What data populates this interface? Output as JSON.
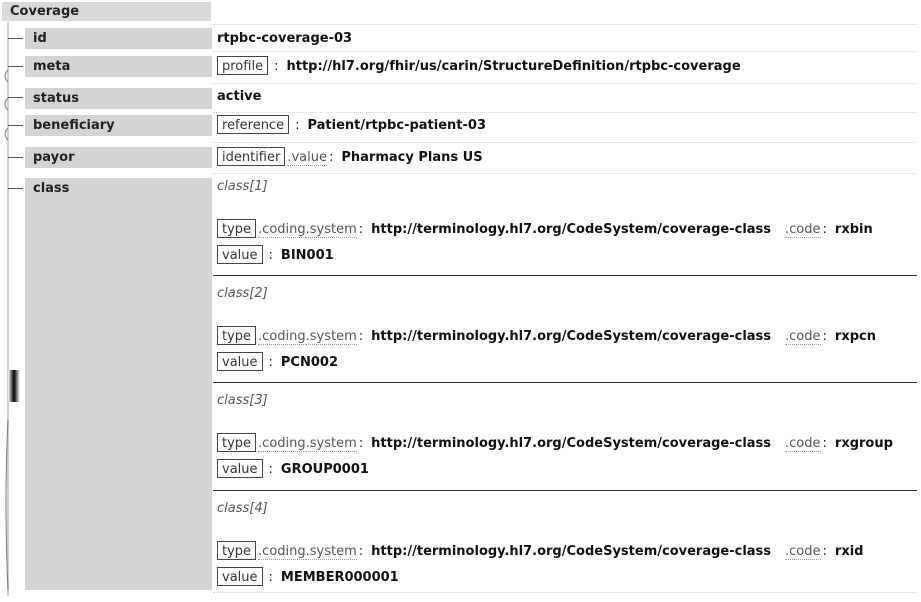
{
  "root": {
    "label": "Coverage"
  },
  "fields": {
    "id": {
      "label": "id",
      "value": "rtpbc-coverage-03"
    },
    "meta": {
      "label": "meta",
      "key": "profile",
      "value": "http://hl7.org/fhir/us/carin/StructureDefinition/rtpbc-coverage"
    },
    "status": {
      "label": "status",
      "value": "active"
    },
    "beneficiary": {
      "label": "beneficiary",
      "key": "reference",
      "value": "Patient/rtpbc-patient-03"
    },
    "payor": {
      "label": "payor",
      "key": "identifier",
      "sub": ".value",
      "value": "Pharmacy Plans US"
    },
    "class": {
      "label": "class"
    }
  },
  "common": {
    "type_key": "type",
    "coding": ".coding",
    "system_sub": ".system",
    "code_sub": ".code",
    "value_key": "value",
    "colon": ":"
  },
  "classes": [
    {
      "index": "class[1]",
      "system": "http://terminology.hl7.org/CodeSystem/coverage-class",
      "code": "rxbin",
      "value": "BIN001"
    },
    {
      "index": "class[2]",
      "system": "http://terminology.hl7.org/CodeSystem/coverage-class",
      "code": "rxpcn",
      "value": "PCN002"
    },
    {
      "index": "class[3]",
      "system": "http://terminology.hl7.org/CodeSystem/coverage-class",
      "code": "rxgroup",
      "value": "GROUP0001"
    },
    {
      "index": "class[4]",
      "system": "http://terminology.hl7.org/CodeSystem/coverage-class",
      "code": "rxid",
      "value": "MEMBER000001"
    }
  ]
}
